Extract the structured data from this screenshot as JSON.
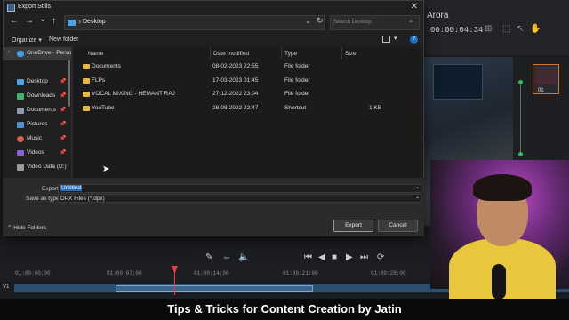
{
  "window": {
    "title": "Export Stills"
  },
  "navigation": {
    "back": "←",
    "forward": "→",
    "dropdown": "⌄",
    "up": "↑"
  },
  "address": {
    "path": "Desktop",
    "separator": "›"
  },
  "search": {
    "placeholder": "Search Desktop"
  },
  "commands": {
    "organize": "Organize ▾",
    "new_folder": "New folder"
  },
  "sidebar": {
    "items": [
      {
        "label": "OneDrive - Perso",
        "icon": "cloud-icon",
        "color": "#4a9be0"
      },
      {
        "label": "Desktop",
        "icon": "desktop-icon",
        "color": "#4fa3e0"
      },
      {
        "label": "Downloads",
        "icon": "download-icon",
        "color": "#3fb56b"
      },
      {
        "label": "Documents",
        "icon": "document-icon",
        "color": "#8a9bb0"
      },
      {
        "label": "Pictures",
        "icon": "picture-icon",
        "color": "#4f8fd8"
      },
      {
        "label": "Music",
        "icon": "music-icon",
        "color": "#d9624b"
      },
      {
        "label": "Videos",
        "icon": "video-icon",
        "color": "#8b5dd6"
      },
      {
        "label": "Video Data (D:)",
        "icon": "drive-icon",
        "color": "#9a9a9a"
      }
    ]
  },
  "columns": {
    "name": "Name",
    "date": "Date modified",
    "type": "Type",
    "size": "Size"
  },
  "files": [
    {
      "name": "Documents",
      "date": "08-02-2023 22:55",
      "type": "File folder",
      "size": ""
    },
    {
      "name": "FLPs",
      "date": "17-03-2023 01:45",
      "type": "File folder",
      "size": ""
    },
    {
      "name": "VOCAL MIXING - HEMANT RAJ",
      "date": "27-12-2022 23:04",
      "type": "File folder",
      "size": ""
    },
    {
      "name": "YouTube",
      "date": "28-08-2022 22:47",
      "type": "Shortcut",
      "size": "1 KB"
    }
  ],
  "form": {
    "export_label": "Export",
    "export_value": "Untitled",
    "type_label": "Save as type:",
    "type_value": "DPX Files (*.dpx)"
  },
  "footer": {
    "hide_folders": "Hide Folders",
    "export_button": "Export",
    "cancel_button": "Cancel"
  },
  "resolve": {
    "project_name": "Arora",
    "timecode": "00:00:04:34",
    "node_number": "01",
    "ruler": [
      "01:00:00:00",
      "01:00:07:00",
      "01:00:14:00",
      "01:00:21:00",
      "01:00:28:00"
    ],
    "track_label": "V1"
  },
  "caption": "Tips & Tricks for Content Creation by Jatin"
}
